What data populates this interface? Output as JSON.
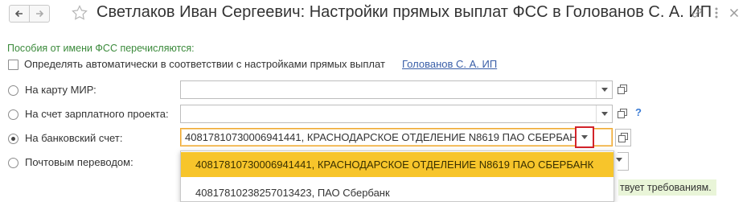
{
  "window": {
    "title": "Светлаков Иван Сергеевич: Настройки прямых выплат ФСС в Голованов С. А. ИП",
    "icons": [
      "arrow-left-icon",
      "arrow-right-icon",
      "star-icon",
      "link-icon",
      "more-icon",
      "close-icon"
    ]
  },
  "form": {
    "section_title": "Пособия от имени ФСС перечисляются:",
    "auto_checkbox": {
      "label": "Определять автоматически в соответствии с настройками прямых выплат",
      "checked": false,
      "org_link": "Голованов С. А. ИП"
    },
    "options": [
      {
        "label": "На карту МИР:",
        "selected": false,
        "value": ""
      },
      {
        "label": "На счет зарплатного проекта:",
        "selected": false,
        "value": "",
        "help": "?"
      },
      {
        "label": "На банковский счет:",
        "selected": true,
        "value": "40817810730006941441, КРАСНОДАРСКОЕ ОТДЕЛЕНИЕ N8619 ПАО СБЕРБАНК"
      },
      {
        "label": "Почтовым переводом:",
        "selected": false,
        "value": ""
      }
    ],
    "dropdown": {
      "items": [
        "40817810730006941441, КРАСНОДАРСКОЕ ОТДЕЛЕНИЕ N8619 ПАО СБЕРБАНК",
        "40817810238257013423, ПАО Сбербанк"
      ],
      "selected_index": 0
    },
    "partial_message": "твует требованиям."
  },
  "colors": {
    "accent_yellow": "#f7c52b",
    "section_green": "#3b8a3b",
    "link_blue": "#3a5fa8",
    "highlight_red": "#d2232a",
    "focus_orange": "#f0a830"
  }
}
